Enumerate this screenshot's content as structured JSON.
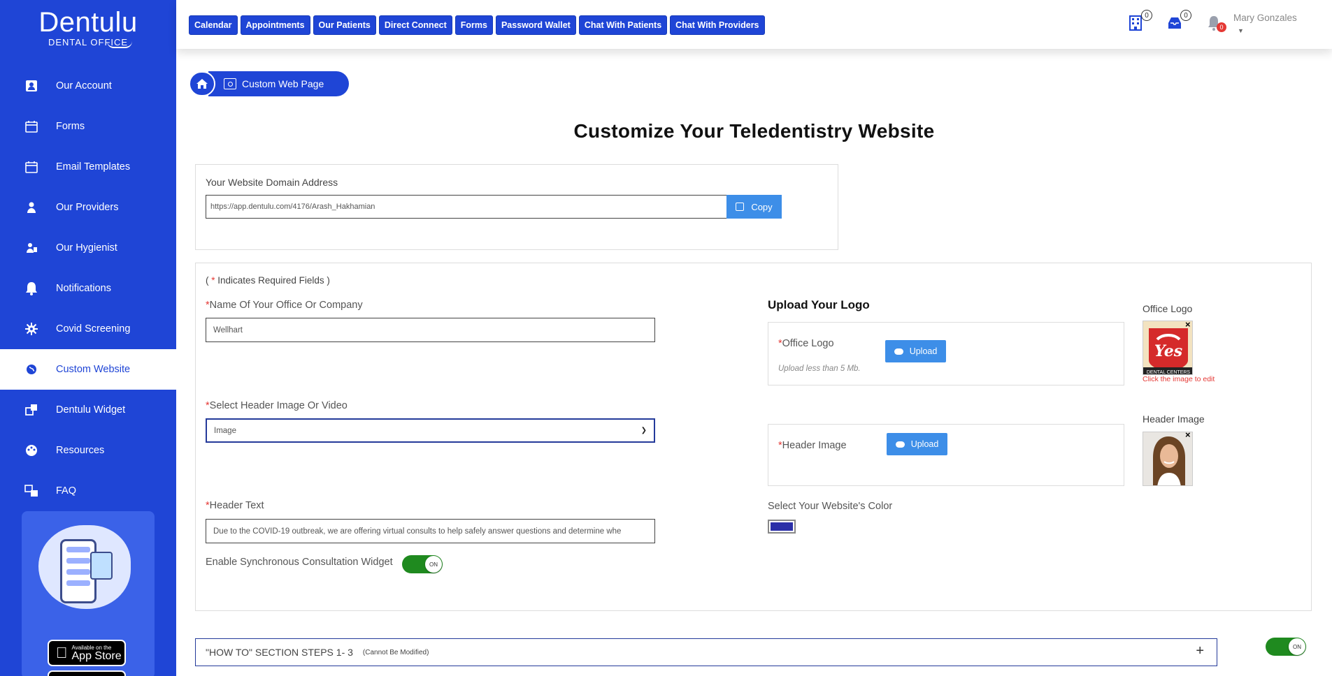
{
  "brand": {
    "name": "Dentulu",
    "subtitle": "DENTAL OFFICE"
  },
  "sidebar": {
    "items": [
      {
        "label": "Our Account",
        "icon": "account-icon"
      },
      {
        "label": "Forms",
        "icon": "calendar-icon"
      },
      {
        "label": "Email Templates",
        "icon": "calendar-icon"
      },
      {
        "label": "Our Providers",
        "icon": "provider-icon"
      },
      {
        "label": "Our Hygienist",
        "icon": "hygienist-icon"
      },
      {
        "label": "Notifications",
        "icon": "bell-icon"
      },
      {
        "label": "Covid Screening",
        "icon": "virus-icon"
      },
      {
        "label": "Custom Website",
        "icon": "globe-icon",
        "active": true
      },
      {
        "label": "Dentulu Widget",
        "icon": "widget-icon"
      },
      {
        "label": "Resources",
        "icon": "palette-icon"
      },
      {
        "label": "FAQ",
        "icon": "faq-icon"
      }
    ],
    "appstore": {
      "small": "Available on the",
      "big": "App Store"
    }
  },
  "topnav": [
    "Calendar",
    "Appointments",
    "Our Patients",
    "Direct Connect",
    "Forms",
    "Password Wallet",
    "Chat With Patients",
    "Chat With Providers"
  ],
  "topicons": {
    "building_count": "0",
    "inbox_count": "0",
    "bell_count": "0"
  },
  "user": {
    "name": "Mary Gonzales"
  },
  "breadcrumb": {
    "page": "Custom Web Page"
  },
  "page_title": "Customize Your Teledentistry Website",
  "domain": {
    "label": "Your Website Domain Address",
    "value": "https://app.dentulu.com/4176/Arash_Hakhamian",
    "copy_label": "Copy"
  },
  "form": {
    "required_note": "Indicates Required Fields )",
    "required_open": "( ",
    "office_name_label": "Name Of Your Office Or Company",
    "office_name_value": "Wellhart",
    "header_select_label": "Select Header Image Or Video",
    "header_select_value": "Image",
    "header_text_label": "Header Text",
    "header_text_value": "Due to the COVID-19 outbreak, we are offering virtual consults to help safely answer questions and determine whe",
    "sync_label": "Enable Synchronous Consultation Widget",
    "toggle_on": "ON"
  },
  "upload": {
    "title": "Upload Your Logo",
    "office_logo_label": "Office Logo",
    "upload_btn": "Upload",
    "hint": "Upload less than 5 Mb.",
    "header_image_label": "Header Image",
    "side_office_logo": "Office Logo",
    "side_header_image": "Header Image",
    "edit_note": "Click the image to edit",
    "logo_text": "DENTAL CENTERS",
    "color_label": "Select Your Website's Color",
    "color_value": "#2b2fa8",
    "close_symbol": "×"
  },
  "howto": {
    "label": "\"HOW TO\" SECTION STEPS 1- 3",
    "note": "(Cannot Be Modified)",
    "plus": "+",
    "toggle": "ON"
  },
  "colors": {
    "primary": "#1f45d6",
    "button": "#3d8ee8",
    "toggle": "#1f8a1f",
    "required": "#e53935"
  }
}
